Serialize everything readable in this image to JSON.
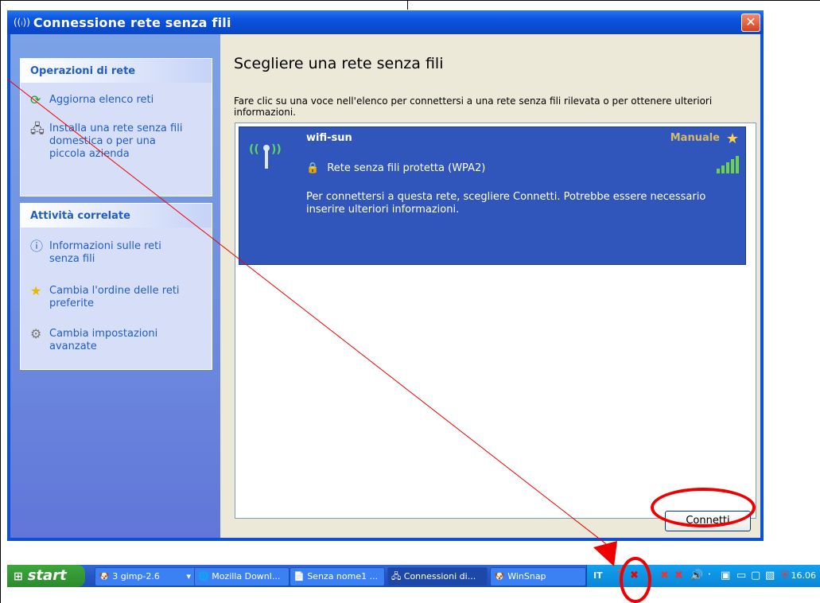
{
  "window": {
    "title": "Connessione rete senza fili",
    "close": "✕"
  },
  "sidebar": {
    "network_tasks": {
      "header": "Operazioni di rete",
      "items": [
        {
          "label": "Aggiorna elenco reti",
          "icon": "refresh-icon"
        },
        {
          "label": "Installa una rete senza fili domestica o per una piccola azienda",
          "icon": "network-setup-icon"
        }
      ]
    },
    "related_tasks": {
      "header": "Attività correlate",
      "items": [
        {
          "label": "Informazioni sulle reti senza fili",
          "icon": "info-icon"
        },
        {
          "label": "Cambia l'ordine delle reti preferite",
          "icon": "star-icon"
        },
        {
          "label": "Cambia impostazioni avanzate",
          "icon": "settings-icon"
        }
      ]
    }
  },
  "main": {
    "title": "Scegliere una rete senza fili",
    "instructions": "Fare clic su una voce nell'elenco per connettersi a una rete senza fili rilevata o per ottenere ulteriori informazioni.",
    "network": {
      "ssid": "wifi-sun",
      "mode": "Manuale",
      "security": "Rete senza fili protetta (WPA2)",
      "description": "Per connettersi a questa rete, scegliere Connetti. Potrebbe essere necessario inserire ulteriori informazioni.",
      "signal_strength": 1.0
    },
    "connect_button": "Connetti"
  },
  "taskbar": {
    "start_label": "start",
    "tasks": [
      {
        "label": "3 gimp-2.6",
        "icon": "gimp-icon"
      },
      {
        "label": "Mozilla Downl...",
        "icon": "mozilla-icon"
      },
      {
        "label": "Senza nome1 ...",
        "icon": "document-icon"
      },
      {
        "label": "Connessioni di...",
        "icon": "network-connections-icon",
        "active": true
      },
      {
        "label": "WinSnap",
        "icon": "winsnap-icon"
      }
    ],
    "tray": {
      "language": "IT",
      "time": "16.06"
    }
  },
  "colors": {
    "titlebar": "#0a4bd0",
    "selection": "#3055bb",
    "sidebar": "#6f8fe0",
    "annotation": "#e00000"
  }
}
